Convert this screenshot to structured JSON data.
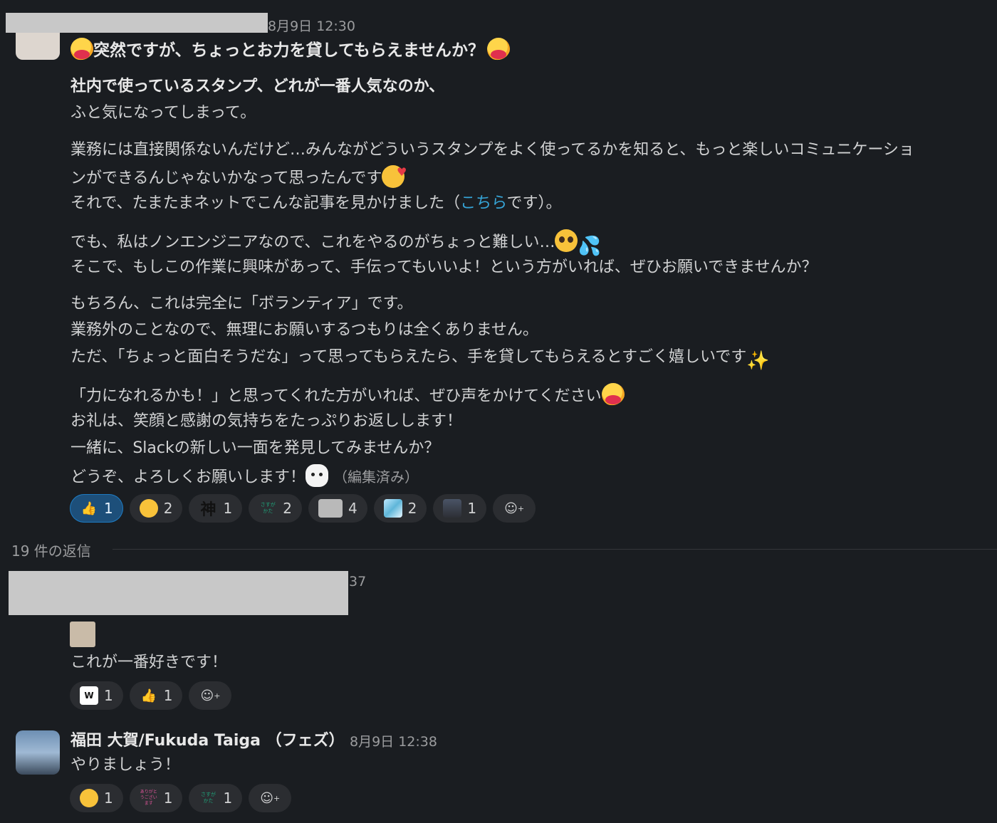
{
  "message1": {
    "timestamp": "8月9日 12:30",
    "lines": [
      "突然ですが、ちょっとお力を貸してもらえませんか？",
      "社内で使っているスタンプ、どれが一番人気なのか、",
      "ふと気になってしまって。",
      "業務には直接関係ないんだけど…みんながどういうスタンプをよく使ってるかを知ると、もっと楽しいコミュニケーショ",
      "ンができるんじゃないかなって思ったんです",
      "それで、たまたまネットでこんな記事を見かけました（",
      "こちら",
      "です）。",
      "でも、私はノンエンジニアなので、これをやるのがちょっと難しい…",
      "そこで、もしこの作業に興味があって、手伝ってもいいよ！という方がいれば、ぜひお願いできませんか？",
      "もちろん、これは完全に「ボランティア」です。",
      "業務外のことなので、無理にお願いするつもりは全くありません。",
      "ただ、「ちょっと面白そうだな」って思ってもらえたら、手を貸してもらえるとすごく嬉しいです",
      "「力になれるかも！」と思ってくれた方がいれば、ぜひ声をかけてください",
      "お礼は、笑顔と感謝の気持ちをたっぷりお返しします！",
      "一緒に、Slackの新しい一面を発見してみませんか？",
      "どうぞ、よろしくお願いします！"
    ],
    "edited": "（編集済み）",
    "reactions": [
      {
        "icon": "thumbs-up-icon",
        "glyph": "👍",
        "count": "1",
        "active": true
      },
      {
        "icon": "saluting-face-icon",
        "glyph": "",
        "count": "2"
      },
      {
        "icon": "kami-stamp-icon",
        "glyph": "神",
        "count": "1"
      },
      {
        "icon": "sasuga-stamp-icon",
        "glyph": "さすがかた",
        "count": "2"
      },
      {
        "icon": "custom-stamp-icon",
        "glyph": "",
        "count": "4"
      },
      {
        "icon": "sparkle-image-icon",
        "glyph": "",
        "count": "2"
      },
      {
        "icon": "person-photo-icon",
        "glyph": "",
        "count": "1"
      }
    ]
  },
  "thread": {
    "replies_label": "19 件の返信"
  },
  "reply1": {
    "timestamp": "37",
    "text": "これが一番好きです！",
    "reactions": [
      {
        "icon": "w-stamp-icon",
        "glyph": "W",
        "count": "1"
      },
      {
        "icon": "thumbs-up-light-icon",
        "glyph": "👍",
        "count": "1"
      }
    ]
  },
  "reply2": {
    "author": "福田 大賀/Fukuda Taiga （フェズ）",
    "timestamp": "8月9日 12:38",
    "text": "やりましょう！",
    "reactions": [
      {
        "icon": "saluting-face-icon",
        "glyph": "",
        "count": "1"
      },
      {
        "icon": "arigatou-stamp-icon",
        "glyph": "ありがとうございます",
        "count": "1"
      },
      {
        "icon": "sasuga-stamp-icon",
        "glyph": "さすがかた",
        "count": "1"
      }
    ]
  },
  "colors": {
    "background": "#1a1d21",
    "text": "#d1d2d3",
    "link": "#36a5d8",
    "active_reaction": "#1d4f7a"
  }
}
